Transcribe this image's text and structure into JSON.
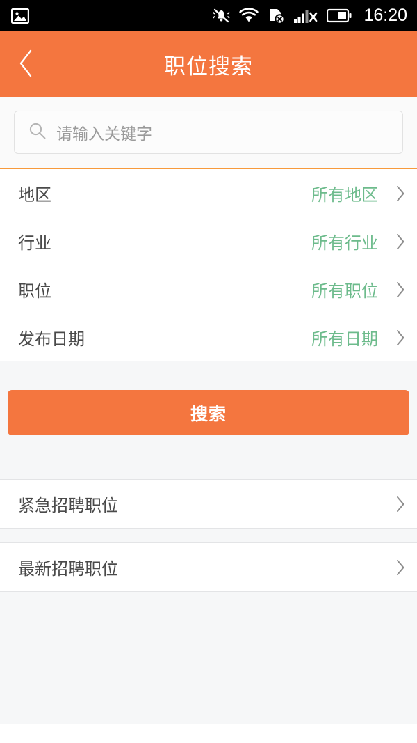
{
  "status_bar": {
    "icons_left": [
      "image-notification-icon"
    ],
    "icons_right": [
      "mute-vibrate-icon",
      "wifi-icon",
      "sim-error-icon",
      "signal-no-service-icon",
      "battery-icon"
    ],
    "time": "16:20"
  },
  "header": {
    "back_icon": "chevron-left-icon",
    "title": "职位搜索",
    "background": "#f4763f"
  },
  "search": {
    "icon": "search-icon",
    "placeholder": "请输入关键字",
    "value": ""
  },
  "filters": [
    {
      "label": "地区",
      "value": "所有地区",
      "chevron": "chevron-right-icon"
    },
    {
      "label": "行业",
      "value": "所有行业",
      "chevron": "chevron-right-icon"
    },
    {
      "label": "职位",
      "value": "所有职位",
      "chevron": "chevron-right-icon"
    },
    {
      "label": "发布日期",
      "value": "所有日期",
      "chevron": "chevron-right-icon"
    }
  ],
  "search_button": {
    "label": "搜索",
    "color": "#f4763f"
  },
  "links": [
    {
      "label": "紧急招聘职位",
      "chevron": "chevron-right-icon"
    },
    {
      "label": "最新招聘职位",
      "chevron": "chevron-right-icon"
    }
  ],
  "colors": {
    "accent_orange": "#f4763f",
    "divider_orange": "#f79a3c",
    "value_green": "#6dbb8c",
    "page_background": "#f6f7f8",
    "text_primary": "#4a4a4a",
    "text_placeholder": "#9a9a9a"
  }
}
